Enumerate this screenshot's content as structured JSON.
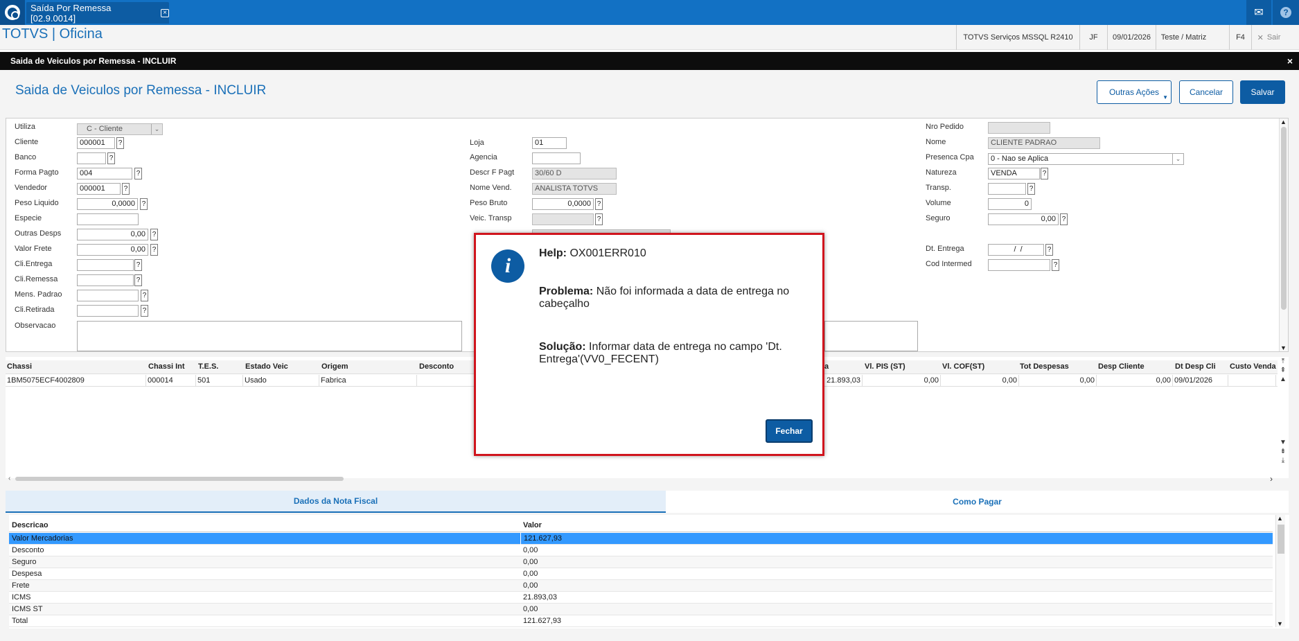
{
  "tab": {
    "title": "Saída Por Remessa [02.9.0014]"
  },
  "app": {
    "title": "TOTVS | Oficina"
  },
  "header": {
    "server": "TOTVS Serviços MSSQL R2410",
    "user": "JF",
    "date": "09/01/2026",
    "branch": "Teste / Matriz",
    "f4": "F4",
    "exit": "Sair"
  },
  "dialog": {
    "title": "Saida de Veiculos por Remessa - INCLUIR"
  },
  "form": {
    "title": "Saida de Veiculos por Remessa - INCLUIR",
    "actions": {
      "outras": "Outras Ações",
      "cancelar": "Cancelar",
      "salvar": "Salvar"
    },
    "col1": [
      {
        "label": "Utiliza",
        "value": "C - Cliente"
      },
      {
        "label": "Cliente",
        "value": "000001"
      },
      {
        "label": "Banco",
        "value": ""
      },
      {
        "label": "Forma Pagto",
        "value": "004"
      },
      {
        "label": "Vendedor",
        "value": "000001"
      },
      {
        "label": "Peso Liquido",
        "value": "0,0000"
      },
      {
        "label": "Especie",
        "value": ""
      },
      {
        "label": "Outras Desps",
        "value": "0,00"
      },
      {
        "label": "Valor Frete",
        "value": "0,00"
      },
      {
        "label": "Cli.Entrega",
        "value": ""
      },
      {
        "label": "Cli.Remessa",
        "value": ""
      },
      {
        "label": "Mens. Padrao",
        "value": ""
      },
      {
        "label": "Cli.Retirada",
        "value": ""
      },
      {
        "label": "Observacao",
        "value": ""
      }
    ],
    "col2": [
      {
        "label": "Loja",
        "value": "01"
      },
      {
        "label": "Agencia",
        "value": ""
      },
      {
        "label": "Descr F Pagt",
        "value": "30/60 D"
      },
      {
        "label": "Nome Vend.",
        "value": "ANALISTA TOTVS"
      },
      {
        "label": "Peso Bruto",
        "value": "0,0000"
      },
      {
        "label": "Veic. Transp",
        "value": ""
      }
    ],
    "col3": [
      {
        "label": "Nro Pedido",
        "value": ""
      },
      {
        "label": "Nome",
        "value": "CLIENTE PADRAO"
      },
      {
        "label": "Presenca Cpa",
        "value": "0 - Nao se Aplica"
      },
      {
        "label": "Natureza",
        "value": "VENDA"
      },
      {
        "label": "Transp.",
        "value": ""
      },
      {
        "label": "Volume",
        "value": "0"
      },
      {
        "label": "Seguro",
        "value": "0,00"
      },
      {
        "label": "Dt. Entrega",
        "value": "  /  /"
      },
      {
        "label": "Cod Intermed",
        "value": ""
      }
    ]
  },
  "grid": {
    "headers": [
      "Chassi",
      "Chassi Int",
      "T.E.S.",
      "Estado Veic",
      "Origem",
      "Desconto",
      "a",
      "Vl. PIS (ST)",
      "Vl. COF(ST)",
      "Tot Despesas",
      "Desp Cliente",
      "Dt Desp Cli",
      "Custo Venda"
    ],
    "row": [
      "1BM5075ECF4002809",
      "000014",
      "501",
      "Usado",
      "Fabrica",
      "",
      "21.893,03",
      "0,00",
      "0,00",
      "0,00",
      "0,00",
      "09/01/2026",
      ""
    ]
  },
  "tabs": {
    "nota": "Dados da Nota Fiscal",
    "pagar": "Como Pagar"
  },
  "nota": {
    "headers": [
      "Descricao",
      "Valor"
    ],
    "rows": [
      [
        "Valor Mercadorias",
        "121.627,93"
      ],
      [
        "Desconto",
        "0,00"
      ],
      [
        "Seguro",
        "0,00"
      ],
      [
        "Despesa",
        "0,00"
      ],
      [
        "Frete",
        "0,00"
      ],
      [
        "ICMS",
        "21.893,03"
      ],
      [
        "ICMS ST",
        "0,00"
      ],
      [
        "Total",
        "121.627,93"
      ]
    ]
  },
  "modal": {
    "help_label": "Help:",
    "help_code": "OX001ERR010",
    "problem_label": "Problema:",
    "problem_text": "Não foi informada a data de entrega no cabeçalho",
    "solution_label": "Solução:",
    "solution_text": "Informar data de entrega no campo 'Dt. Entrega'(VV0_FECENT)",
    "close": "Fechar"
  },
  "colors": {
    "accent": "#0d5ca3",
    "topbar": "#1271c4",
    "modal_border": "#d0141d",
    "selection": "#3399ff"
  },
  "icons": [
    "totvs-logo-icon",
    "close-icon",
    "mail-icon",
    "help-icon",
    "info-icon",
    "chevron-down-icon"
  ]
}
